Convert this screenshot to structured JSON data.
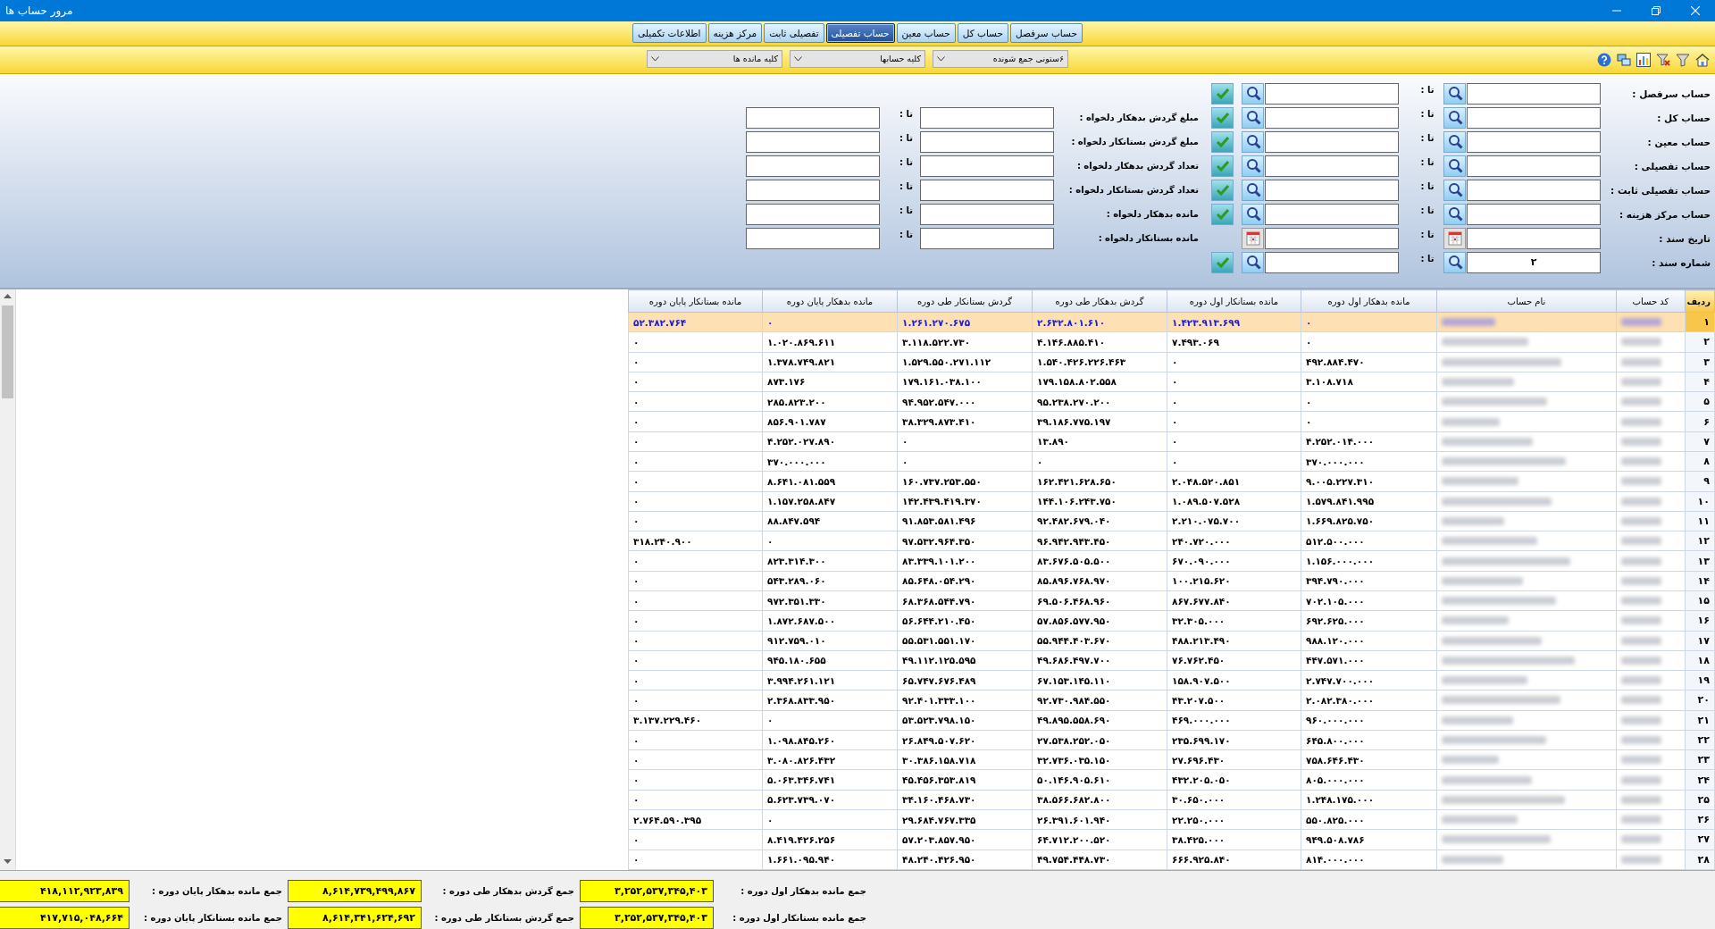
{
  "window": {
    "title": "مرور حساب ها"
  },
  "tabs": [
    {
      "label": "حساب سرفصل",
      "selected": false
    },
    {
      "label": "حساب کل",
      "selected": false
    },
    {
      "label": "حساب معین",
      "selected": false
    },
    {
      "label": "حساب تفصیلی",
      "selected": true
    },
    {
      "label": "تفصیلی ثابت",
      "selected": false
    },
    {
      "label": "مرکز هزینه",
      "selected": false
    },
    {
      "label": "اطلاعات تکمیلی",
      "selected": false
    }
  ],
  "toolbar": {
    "dropdowns": [
      {
        "value": "۶ستونی جمع شونده"
      },
      {
        "value": "کلیه حسابها"
      },
      {
        "value": "کلیه مانده ها"
      }
    ]
  },
  "filters": {
    "rows": [
      {
        "label": "حساب سرفصل :",
        "to_label": "تا :",
        "kind": "search",
        "confirm": true
      },
      {
        "label": "حساب کل :",
        "to_label": "تا :",
        "kind": "search",
        "confirm": true
      },
      {
        "label": "حساب معین :",
        "to_label": "تا :",
        "kind": "search",
        "confirm": true
      },
      {
        "label": "حساب تفصیلی :",
        "to_label": "تا :",
        "kind": "search",
        "confirm": true
      },
      {
        "label": "حساب تفصیلی ثابت :",
        "to_label": "تا :",
        "kind": "search",
        "confirm": true
      },
      {
        "label": "حساب مرکز هزینه :",
        "to_label": "تا :",
        "kind": "search",
        "confirm": true
      },
      {
        "label": "تاریخ سند :",
        "to_label": "تا :",
        "kind": "date",
        "confirm": false
      },
      {
        "label": "شماره سند :",
        "from": "۲",
        "to_label": "تا :",
        "kind": "search",
        "confirm": true
      }
    ],
    "amount_rows": [
      {
        "label": "مبلغ گردش بدهکار دلخواه :",
        "to_label": "تا :"
      },
      {
        "label": "مبلغ گردش بستانکار دلخواه :",
        "to_label": "تا :"
      },
      {
        "label": "تعداد گردش بدهکار دلخواه :",
        "to_label": "تا :"
      },
      {
        "label": "تعداد گردش بستانکار دلخواه :",
        "to_label": "تا :"
      },
      {
        "label": "مانده بدهکار دلخواه :",
        "to_label": "تا :"
      },
      {
        "label": "مانده بستانکار دلخواه :",
        "to_label": "تا :"
      }
    ]
  },
  "table": {
    "columns": [
      "ردیف",
      "کد حساب",
      "نام حساب",
      "مانده بدهکار اول دوره",
      "مانده بستانکار اول دوره",
      "گردش بدهکار طی دوره",
      "گردش بستانکار طی دوره",
      "مانده بدهکار پایان دوره",
      "مانده بستانکار پایان دوره"
    ],
    "rows": [
      {
        "row": "۱",
        "selected": true,
        "values": [
          "۰",
          "۱.۴۲۳.۹۱۳.۶۹۹",
          "۲.۶۳۲.۸۰۱.۶۱۰",
          "۱.۲۶۱.۲۷۰.۶۷۵",
          "۰",
          "۵۲.۳۸۲.۷۶۴"
        ]
      },
      {
        "row": "۲",
        "selected": false,
        "values": [
          "۰",
          "۷.۴۹۳.۰۶۹",
          "۴.۱۴۶.۸۸۵.۴۱۰",
          "۳.۱۱۸.۵۲۲.۷۳۰",
          "۱.۰۲۰.۸۶۹.۶۱۱",
          "۰"
        ]
      },
      {
        "row": "۳",
        "selected": false,
        "values": [
          "۴۹۲.۸۸۴.۴۷۰",
          "۰",
          "۱.۵۴۰.۴۲۶.۲۲۶.۴۶۳",
          "۱.۵۲۹.۵۵۰.۲۷۱.۱۱۲",
          "۱.۳۷۸.۷۴۹.۸۲۱",
          "۰"
        ]
      },
      {
        "row": "۴",
        "selected": false,
        "values": [
          "۳.۱۰۸.۷۱۸",
          "۰",
          "۱۷۹.۱۵۸.۸۰۲.۵۵۸",
          "۱۷۹.۱۶۱.۰۳۸.۱۰۰",
          "۸۷۳.۱۷۶",
          "۰"
        ]
      },
      {
        "row": "۵",
        "selected": false,
        "values": [
          "۰",
          "۰",
          "۹۵.۲۳۸.۲۷۰.۲۰۰",
          "۹۴.۹۵۲.۵۴۷.۰۰۰",
          "۲۸۵.۸۲۳.۲۰۰",
          "۰"
        ]
      },
      {
        "row": "۶",
        "selected": false,
        "values": [
          "۰",
          "۰",
          "۳۹.۱۸۶.۷۷۵.۱۹۷",
          "۳۸.۳۲۹.۸۷۳.۴۱۰",
          "۸۵۶.۹۰۱.۷۸۷",
          "۰"
        ]
      },
      {
        "row": "۷",
        "selected": false,
        "values": [
          "۴.۲۵۲.۰۱۴.۰۰۰",
          "۰",
          "۱۳.۸۹۰",
          "۰",
          "۴.۲۵۲.۰۲۷.۸۹۰",
          "۰"
        ]
      },
      {
        "row": "۸",
        "selected": false,
        "values": [
          "۳۷۰.۰۰۰.۰۰۰",
          "۰",
          "۰",
          "۰",
          "۳۷۰.۰۰۰.۰۰۰",
          "۰"
        ]
      },
      {
        "row": "۹",
        "selected": false,
        "values": [
          "۹.۰۰۵.۲۲۷.۳۱۰",
          "۲.۰۴۸.۵۲۰.۸۵۱",
          "۱۶۲.۴۲۱.۶۲۸.۶۵۰",
          "۱۶۰.۷۳۷.۲۵۳.۵۵۰",
          "۸.۶۴۱.۰۸۱.۵۵۹",
          "۰"
        ]
      },
      {
        "row": "۱۰",
        "selected": false,
        "values": [
          "۱.۵۷۹.۸۴۱.۹۹۵",
          "۱.۰۸۹.۵۰۷.۵۲۸",
          "۱۴۴.۱۰۶.۲۴۳.۷۵۰",
          "۱۴۲.۴۳۹.۴۱۹.۳۷۰",
          "۱.۱۵۷.۲۵۸.۸۴۷",
          "۰"
        ]
      },
      {
        "row": "۱۱",
        "selected": false,
        "values": [
          "۱.۶۶۹.۸۲۵.۷۵۰",
          "۲.۲۱۰.۰۷۵.۷۰۰",
          "۹۲.۴۸۲.۶۷۹.۰۴۰",
          "۹۱.۸۵۳.۵۸۱.۴۹۶",
          "۸۸.۸۴۷.۵۹۴",
          "۰"
        ]
      },
      {
        "row": "۱۲",
        "selected": false,
        "values": [
          "۵۱۲.۵۰۰.۰۰۰",
          "۲۴۰.۷۲۰.۰۰۰",
          "۹۶.۹۴۲.۹۴۳.۴۵۰",
          "۹۷.۵۳۲.۹۶۴.۳۵۰",
          "۰",
          "۳۱۸.۲۴۰.۹۰۰"
        ]
      },
      {
        "row": "۱۳",
        "selected": false,
        "values": [
          "۱.۱۵۶.۰۰۰.۰۰۰",
          "۶۷۰.۰۹۰.۰۰۰",
          "۸۳.۶۷۶.۵۰۵.۵۰۰",
          "۸۳.۳۳۹.۱۰۱.۲۰۰",
          "۸۲۳.۳۱۴.۳۰۰",
          "۰"
        ]
      },
      {
        "row": "۱۴",
        "selected": false,
        "values": [
          "۳۹۴.۷۹۰.۰۰۰",
          "۱۰۰.۲۱۵.۶۲۰",
          "۸۵.۸۹۶.۷۶۸.۹۷۰",
          "۸۵.۶۴۸.۰۵۴.۲۹۰",
          "۵۴۳.۲۸۹.۰۶۰",
          "۰"
        ]
      },
      {
        "row": "۱۵",
        "selected": false,
        "values": [
          "۷۰۲.۱۰۵.۰۰۰",
          "۸۶۷.۶۷۷.۸۴۰",
          "۶۹.۵۰۶.۴۶۸.۹۶۰",
          "۶۸.۳۶۸.۵۴۴.۷۹۰",
          "۹۷۲.۳۵۱.۳۳۰",
          "۰"
        ]
      },
      {
        "row": "۱۶",
        "selected": false,
        "values": [
          "۶۹۲.۶۲۵.۰۰۰",
          "۳۲.۳۰۵.۰۰۰",
          "۵۷.۸۵۶.۵۷۷.۹۵۰",
          "۵۶.۶۴۴.۲۱۰.۴۵۰",
          "۱.۸۷۲.۶۸۷.۵۰۰",
          "۰"
        ]
      },
      {
        "row": "۱۷",
        "selected": false,
        "values": [
          "۹۸۸.۱۲۰.۰۰۰",
          "۴۸۸.۲۱۳.۴۹۰",
          "۵۵.۹۴۴.۴۰۳.۶۷۰",
          "۵۵.۵۳۱.۵۵۱.۱۷۰",
          "۹۱۲.۷۵۹.۰۱۰",
          "۰"
        ]
      },
      {
        "row": "۱۸",
        "selected": false,
        "values": [
          "۴۴۷.۵۷۱.۰۰۰",
          "۷۶.۷۶۲.۴۵۰",
          "۴۹.۶۸۶.۴۹۷.۷۰۰",
          "۴۹.۱۱۲.۱۲۵.۵۹۵",
          "۹۴۵.۱۸۰.۶۵۵",
          "۰"
        ]
      },
      {
        "row": "۱۹",
        "selected": false,
        "values": [
          "۲.۷۴۷.۷۰۰.۰۰۰",
          "۱۵۸.۹۰۷.۵۰۰",
          "۶۷.۱۵۳.۱۴۵.۱۱۰",
          "۶۵.۷۴۷.۶۷۶.۴۸۹",
          "۳.۹۹۴.۲۶۱.۱۲۱",
          "۰"
        ]
      },
      {
        "row": "۲۰",
        "selected": false,
        "values": [
          "۲.۰۸۲.۳۸۰.۰۰۰",
          "۴۳.۲۰۷.۵۰۰",
          "۹۲.۷۳۰.۹۸۴.۵۵۰",
          "۹۲.۴۰۱.۳۳۳.۱۰۰",
          "۲.۳۶۸.۸۳۳.۹۵۰",
          "۰"
        ]
      },
      {
        "row": "۲۱",
        "selected": false,
        "values": [
          "۹۶۰.۰۰۰.۰۰۰",
          "۴۶۹.۰۰۰.۰۰۰",
          "۴۹.۸۹۵.۵۵۸.۶۹۰",
          "۵۳.۵۲۳.۷۹۸.۱۵۰",
          "۰",
          "۳.۱۳۷.۲۲۹.۴۶۰"
        ]
      },
      {
        "row": "۲۲",
        "selected": false,
        "values": [
          "۶۴۵.۸۰۰.۰۰۰",
          "۲۳۵.۶۹۹.۱۷۰",
          "۲۷.۵۳۸.۲۵۲.۰۵۰",
          "۲۶.۸۴۹.۵۰۷.۶۲۰",
          "۱.۰۹۸.۸۴۵.۲۶۰",
          "۰"
        ]
      },
      {
        "row": "۲۳",
        "selected": false,
        "values": [
          "۷۵۸.۶۴۶.۴۳۰",
          "۲۷.۶۹۶.۴۳۰",
          "۳۲.۷۳۶.۰۳۵.۱۵۰",
          "۳۰.۳۸۶.۱۵۸.۷۱۸",
          "۳.۰۸۰.۸۲۶.۴۳۲",
          "۰"
        ]
      },
      {
        "row": "۲۴",
        "selected": false,
        "values": [
          "۸۰۵.۰۰۰.۰۰۰",
          "۴۳۲.۲۰۵.۰۵۰",
          "۵۰.۱۴۶.۹۰۵.۶۱۰",
          "۴۵.۴۵۶.۳۵۳.۸۱۹",
          "۵.۰۶۳.۳۴۶.۷۴۱",
          "۰"
        ]
      },
      {
        "row": "۲۵",
        "selected": false,
        "values": [
          "۱.۲۴۸.۱۷۵.۰۰۰",
          "۳۰.۶۵۰.۰۰۰",
          "۳۸.۵۶۶.۶۸۲.۸۰۰",
          "۳۴.۱۶۰.۴۶۸.۷۳۰",
          "۵.۶۲۳.۷۳۹.۰۷۰",
          "۰"
        ]
      },
      {
        "row": "۲۶",
        "selected": false,
        "values": [
          "۵۵۰.۸۲۵.۰۰۰",
          "۲۲.۲۵۰.۰۰۰",
          "۲۶.۳۹۱.۶۰۱.۹۴۰",
          "۲۹.۶۸۴.۷۶۷.۳۳۵",
          "۰",
          "۲.۷۶۴.۵۹۰.۳۹۵"
        ]
      },
      {
        "row": "۲۷",
        "selected": false,
        "values": [
          "۹۴۹.۵۰۸.۷۸۶",
          "۳۸.۴۲۵.۰۰۰",
          "۶۴.۷۱۲.۲۰۰.۵۲۰",
          "۵۷.۲۰۳.۸۵۷.۹۵۰",
          "۸.۴۱۹.۴۲۶.۲۵۶",
          "۰"
        ]
      },
      {
        "row": "۲۸",
        "selected": false,
        "values": [
          "۸۱۴.۰۰۰.۰۰۰",
          "۶۶۶.۹۲۵.۸۴۰",
          "۴۹.۷۵۴.۴۴۸.۷۳۰",
          "۴۸.۲۴۰.۴۲۶.۹۵۰",
          "۱.۶۶۱.۰۹۵.۹۴۰",
          "۰"
        ]
      }
    ]
  },
  "footer": {
    "rows": [
      [
        {
          "label": "جمع مانده بدهکار اول دوره :",
          "value": "۳,۲۵۲,۵۳۷,۳۴۵,۴۰۳"
        },
        {
          "label": "جمع گردش بدهکار طی دوره :",
          "value": "۸,۶۱۴,۷۳۹,۴۹۹,۸۶۷"
        },
        {
          "label": "جمع مانده بدهکار پایان دوره :",
          "value": "۴۱۸,۱۱۲,۹۲۳,۸۳۹"
        }
      ],
      [
        {
          "label": "جمع مانده بستانکار اول دوره :",
          "value": "۳,۲۵۲,۵۳۷,۳۴۵,۴۰۳"
        },
        {
          "label": "جمع گردش بستانکار طی دوره :",
          "value": "۸,۶۱۴,۳۴۱,۶۲۴,۶۹۲"
        },
        {
          "label": "جمع مانده بستانکار پایان دوره :",
          "value": "۴۱۷,۷۱۵,۰۴۸,۶۶۴"
        }
      ]
    ]
  }
}
